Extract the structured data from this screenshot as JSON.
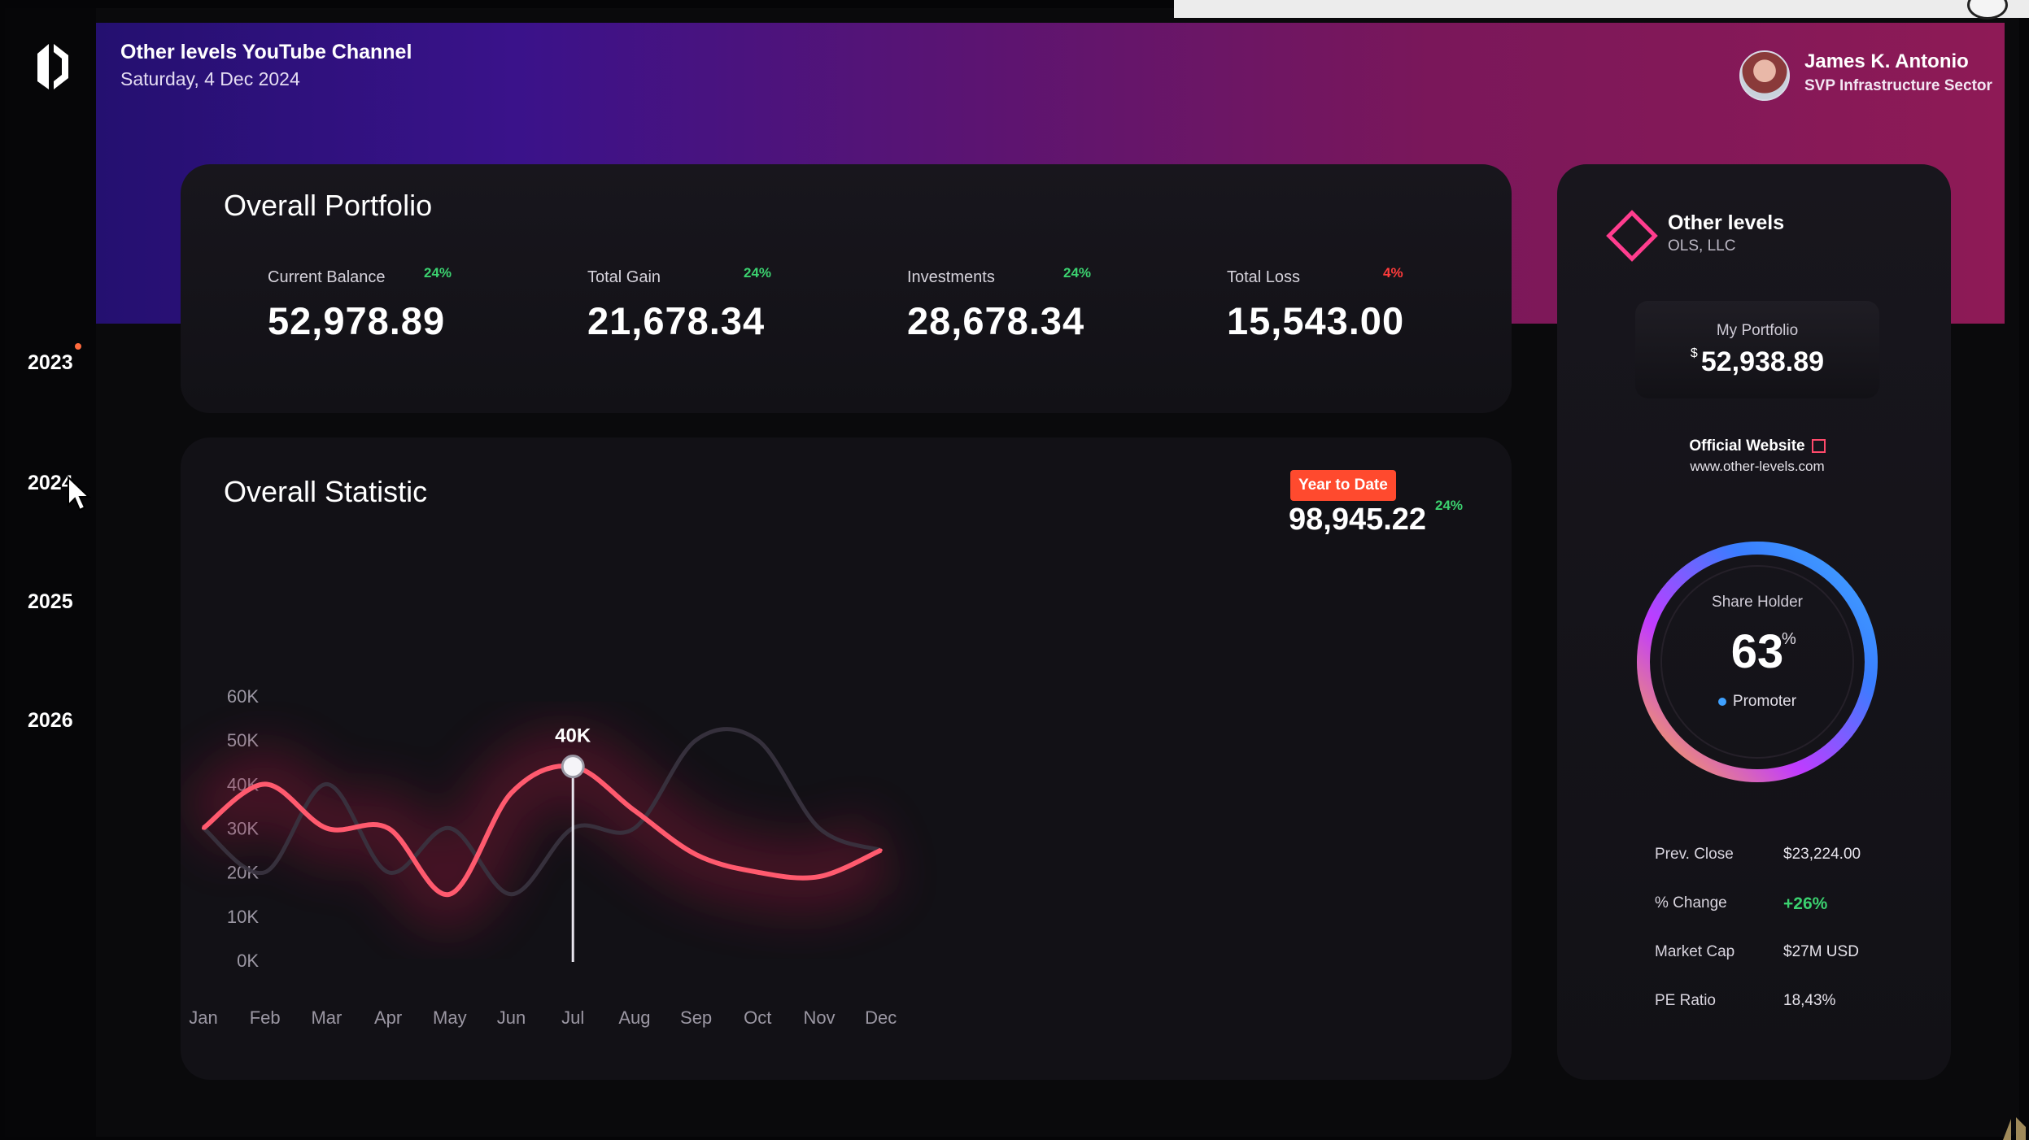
{
  "header": {
    "channel": "Other levels YouTube Channel",
    "date": "Saturday, 4 Dec 2024",
    "user_name": "James K. Antonio",
    "user_role": "SVP Infrastructure Sector"
  },
  "sidebar": {
    "years": [
      "2023",
      "2024",
      "2025",
      "2026"
    ]
  },
  "portfolio": {
    "title": "Overall Portfolio",
    "kpis": [
      {
        "label": "Current Balance",
        "value": "52,978.89",
        "pct": "24%",
        "color": "#3bd16f"
      },
      {
        "label": "Total Gain",
        "value": "21,678.34",
        "pct": "24%",
        "color": "#3bd16f"
      },
      {
        "label": "Investments",
        "value": "28,678.34",
        "pct": "24%",
        "color": "#3bd16f"
      },
      {
        "label": "Total Loss",
        "value": "15,543.00",
        "pct": "4%",
        "color": "#ff3b3b"
      }
    ]
  },
  "statistic": {
    "title": "Overall Statistic",
    "badge": "Year to Date",
    "value": "98,945.22",
    "pct": "24%"
  },
  "chart_data": {
    "type": "line",
    "categories": [
      "Jan",
      "Feb",
      "Mar",
      "Apr",
      "May",
      "Jun",
      "Jul",
      "Aug",
      "Sep",
      "Oct",
      "Nov",
      "Dec"
    ],
    "y_ticks": [
      "0K",
      "10K",
      "20K",
      "30K",
      "40K",
      "50K",
      "60K"
    ],
    "ylim": [
      0,
      60000
    ],
    "series": [
      {
        "values": [
          30000,
          40000,
          30000,
          30000,
          15000,
          38000,
          44000,
          34000,
          24000,
          20000,
          19000,
          25000
        ],
        "color": "#ff5a6e"
      },
      {
        "values": [
          30000,
          20000,
          40000,
          20000,
          30000,
          15000,
          30000,
          30000,
          50000,
          50000,
          30000,
          25000
        ],
        "color": "#3a3440"
      }
    ],
    "highlight": {
      "category": "Jul",
      "label": "40K"
    }
  },
  "side": {
    "brand": "Other levels",
    "brand_sub": "OLS, LLC",
    "portfolio_label": "My Portfolio",
    "portfolio_currency": "$",
    "portfolio_value": "52,938.89",
    "website_label": "Official Website",
    "website_url": "www.other-levels.com",
    "share_label": "Share Holder",
    "share_value": "63",
    "share_unit": "%",
    "share_fraction": 0.63,
    "share_legend": "Promoter",
    "stats": [
      {
        "key": "Prev. Close",
        "value": "$23,224.00",
        "green": false
      },
      {
        "key": "% Change",
        "value": "+26%",
        "green": true
      },
      {
        "key": "Market Cap",
        "value": "$27M USD",
        "green": false
      },
      {
        "key": "PE Ratio",
        "value": "18,43%",
        "green": false
      }
    ]
  }
}
